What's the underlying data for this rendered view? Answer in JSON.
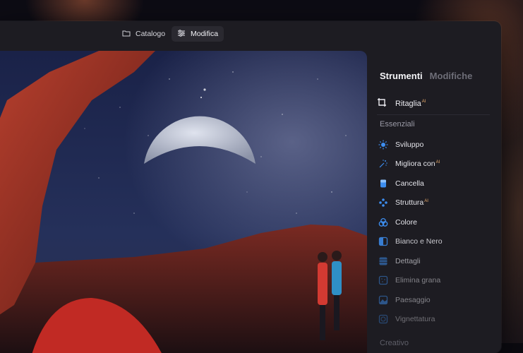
{
  "toolbar": {
    "catalog_label": "Catalogo",
    "edit_label": "Modifica"
  },
  "panel": {
    "tabs": [
      {
        "label": "Strumenti",
        "active": true
      },
      {
        "label": "Modifiche",
        "active": false
      }
    ],
    "crop": {
      "label": "Ritaglia",
      "badge": "AI"
    },
    "essentials_title": "Essenziali",
    "tools": [
      {
        "label": "Sviluppo",
        "icon": "sun-icon",
        "badge": ""
      },
      {
        "label": "Migliora con",
        "icon": "sparkle-icon",
        "badge": "AI"
      },
      {
        "label": "Cancella",
        "icon": "eraser-icon",
        "badge": ""
      },
      {
        "label": "Struttura",
        "icon": "structure-icon",
        "badge": "AI"
      },
      {
        "label": "Colore",
        "icon": "color-circles-icon",
        "badge": ""
      },
      {
        "label": "Bianco e Nero",
        "icon": "black-white-icon",
        "badge": ""
      },
      {
        "label": "Dettagli",
        "icon": "details-icon",
        "badge": ""
      },
      {
        "label": "Elimina grana",
        "icon": "denoise-icon",
        "badge": ""
      },
      {
        "label": "Paesaggio",
        "icon": "landscape-icon",
        "badge": ""
      },
      {
        "label": "Vignettatura",
        "icon": "vignette-icon",
        "badge": ""
      }
    ],
    "creative_title": "Creativo"
  },
  "colors": {
    "accent_blue": "#3d8ef0",
    "ai_badge": "#e6a86a",
    "panel_bg": "#1d1c22"
  }
}
